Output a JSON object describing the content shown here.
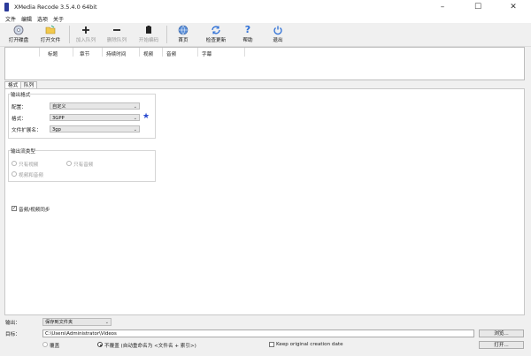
{
  "window": {
    "title": "XMedia Recode 3.5.4.0 64bit"
  },
  "menu": [
    "文件",
    "编辑",
    "选项",
    "关于"
  ],
  "toolbar": {
    "open_disc": "打开碟盘",
    "open_file": "打开文件",
    "add_queue": "加入队列",
    "remove_queue": "删除队列",
    "start_encode": "开始编码",
    "home": "首页",
    "check_update": "检查更新",
    "help": "帮助",
    "exit": "退出"
  },
  "file_list": {
    "columns": [
      "标题",
      "章节",
      "持续时间",
      "视频",
      "音频",
      "字幕"
    ]
  },
  "tabs": [
    "格式",
    "队列"
  ],
  "format_tab": {
    "output_format_group": "输出格式",
    "profile_label": "配置：",
    "profile_value": "自定义",
    "format_label": "格式：",
    "format_value": "3GPP",
    "extension_label": "文件扩展名：",
    "extension_value": "3gp",
    "output_stream_group": "输出流类型",
    "video_only": "只有视频",
    "audio_only": "只有音频",
    "video_and_audio": "视频和音频",
    "av_sync": "音频/视频同步",
    "av_sync_checked": true
  },
  "bottom": {
    "output_label": "输出：",
    "output_value": "保存到文件夹",
    "target_label": "目标：",
    "target_value": "C:\\Users\\Administrator\\Videos",
    "browse": "浏览...",
    "overwrite": "覆盖",
    "no_overwrite": "不覆盖 (自动重命名为 <文件名 + 索引>)",
    "keep_date": "Keep original creation date",
    "open": "打开..."
  }
}
